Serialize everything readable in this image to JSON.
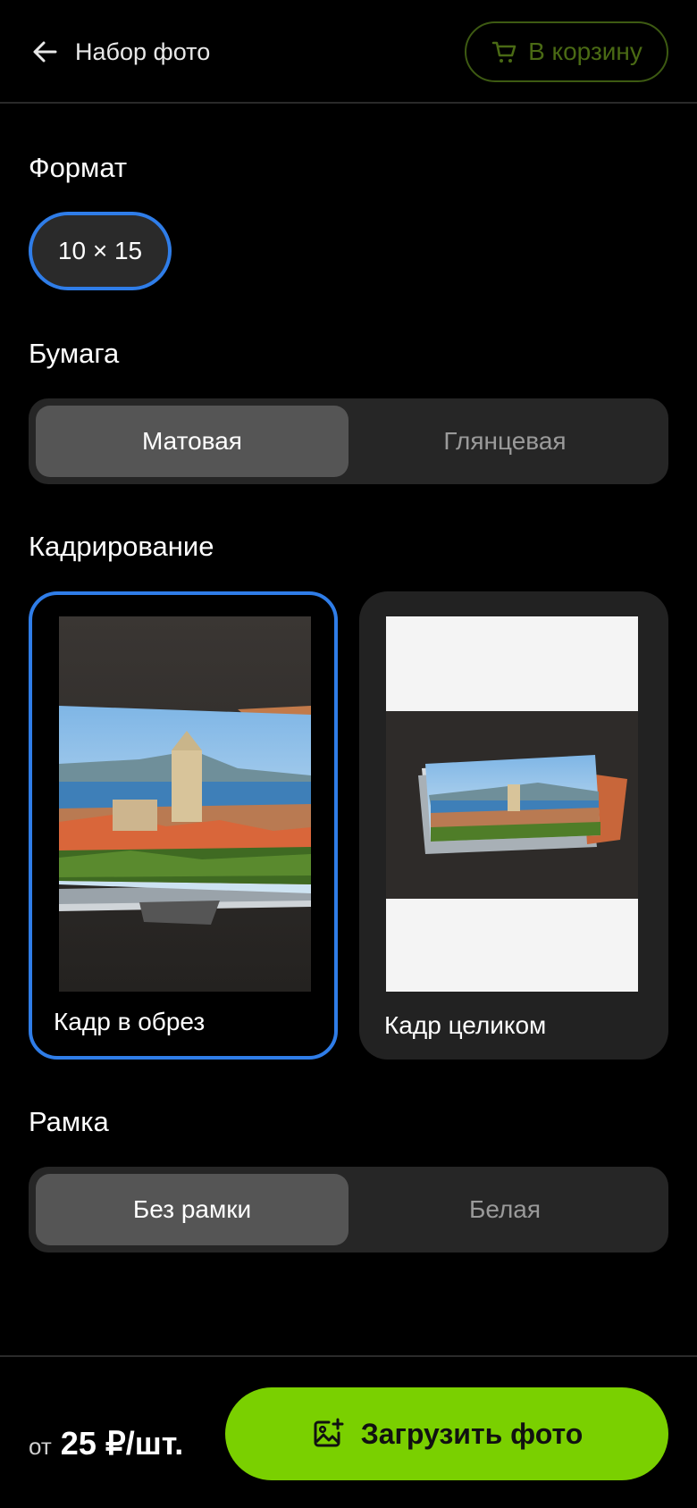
{
  "header": {
    "back_icon": "arrow-left-icon",
    "title": "Набор фото",
    "cart_icon": "cart-icon",
    "cart_label": "В корзину",
    "cart_color": "#4a6a14"
  },
  "format": {
    "title": "Формат",
    "options": [
      {
        "label": "10 × 15",
        "selected": true
      }
    ]
  },
  "paper": {
    "title": "Бумага",
    "options": [
      {
        "label": "Матовая",
        "selected": true
      },
      {
        "label": "Глянцевая",
        "selected": false
      }
    ]
  },
  "cropping": {
    "title": "Кадрирование",
    "options": [
      {
        "label": "Кадр в обрез",
        "selected": true
      },
      {
        "label": "Кадр целиком",
        "selected": false
      }
    ]
  },
  "frame": {
    "title": "Рамка",
    "options": [
      {
        "label": "Без рамки",
        "selected": true
      },
      {
        "label": "Белая",
        "selected": false
      }
    ]
  },
  "footer": {
    "price_prefix": "от",
    "price_value": "25 ₽/шт.",
    "upload_icon": "image-add-icon",
    "upload_label": "Загрузить фото",
    "accent_color": "#7ad000",
    "selection_color": "#2f7de8"
  }
}
